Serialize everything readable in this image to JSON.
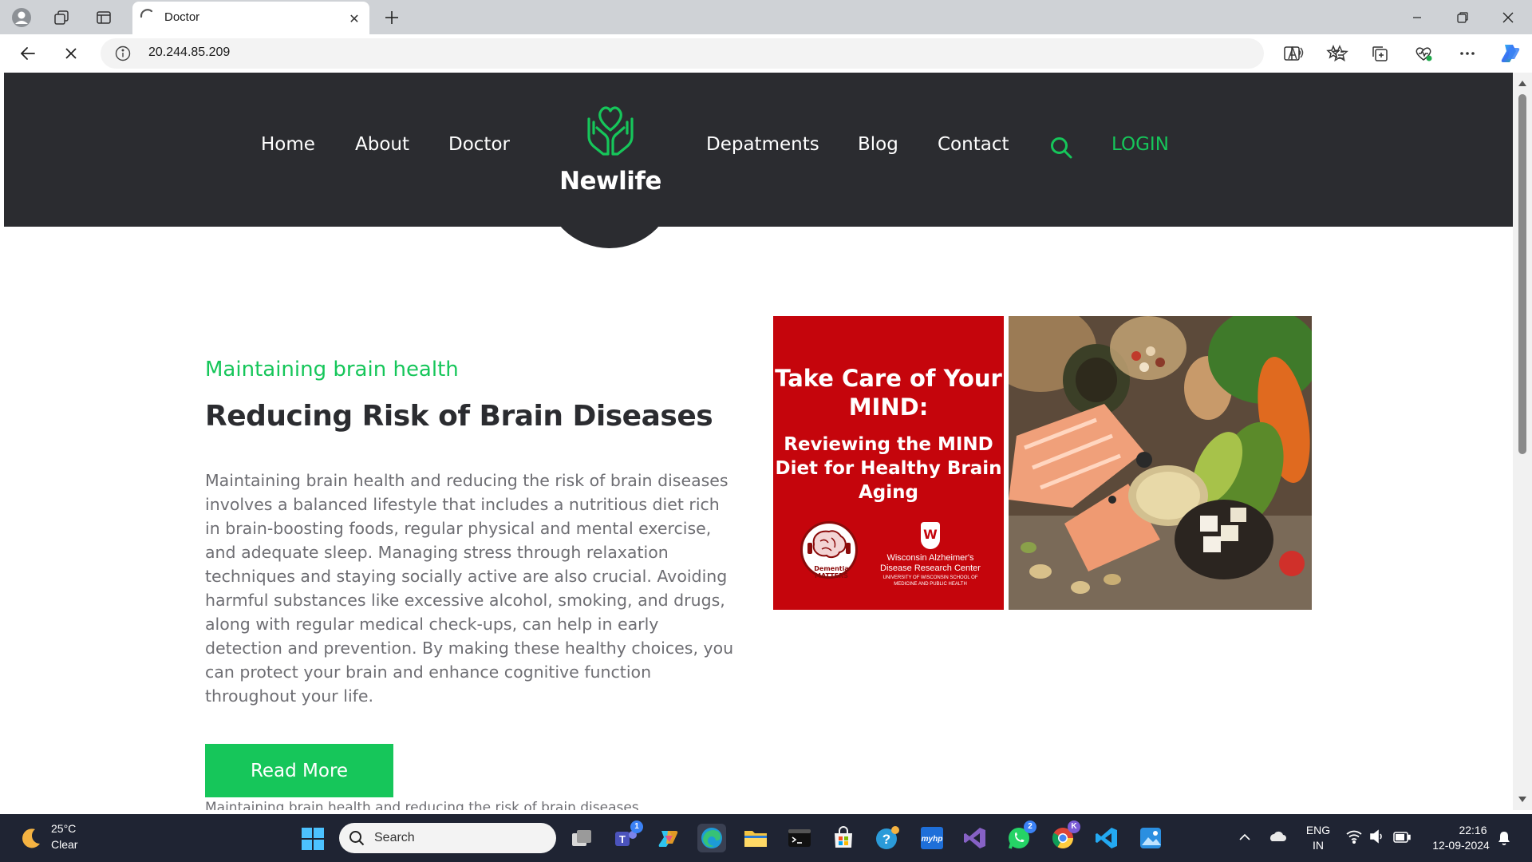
{
  "browser": {
    "tab": {
      "title": "Doctor"
    },
    "address": {
      "url": "20.244.85.209"
    }
  },
  "site": {
    "logo": {
      "name": "Newlife"
    },
    "nav": {
      "home": "Home",
      "about": "About",
      "doctor": "Doctor",
      "departments": "Depatments",
      "blog": "Blog",
      "contact": "Contact",
      "login": "LOGIN"
    },
    "article": {
      "subtitle": "Maintaining brain health",
      "heading": "Reducing Risk of Brain Diseases",
      "body": "Maintaining brain health and reducing the risk of brain diseases involves a balanced lifestyle that includes a nutritious diet rich in brain-boosting foods, regular physical and mental exercise, and adequate sleep. Managing stress through relaxation techniques and staying socially active are also crucial. Avoiding harmful substances like excessive alcohol, smoking, and drugs, along with regular medical check-ups, can help in early detection and prevention. By making these healthy choices, you can protect your brain and enhance cognitive function throughout your life.",
      "read_more": "Read More",
      "next_preview": "Maintaining brain health and reducing the risk of brain diseases"
    },
    "promo": {
      "title": "Take Care of Your MIND:",
      "subtitle": "Reviewing the MIND Diet for Healthy Brain Aging",
      "badge": "Dementia MATTERS",
      "crest": "W",
      "org": "Wisconsin Alzheimer's Disease Research Center",
      "org_small": "UNIVERSITY OF WISCONSIN SCHOOL OF MEDICINE AND PUBLIC HEALTH"
    }
  },
  "taskbar": {
    "weather": {
      "temp": "25°C",
      "condition": "Clear"
    },
    "search_placeholder": "Search",
    "language": {
      "lang": "ENG",
      "region": "IN"
    },
    "clock": {
      "time": "22:16",
      "date": "12-09-2024"
    },
    "badges": {
      "teams": "1",
      "whatsapp": "2",
      "chrome": "K"
    },
    "hp_label": "myhp"
  },
  "colors": {
    "accent_green": "#16c65a",
    "header_dark": "#2b2c30",
    "promo_red": "#c5050c",
    "taskbar": "#1f2433"
  }
}
